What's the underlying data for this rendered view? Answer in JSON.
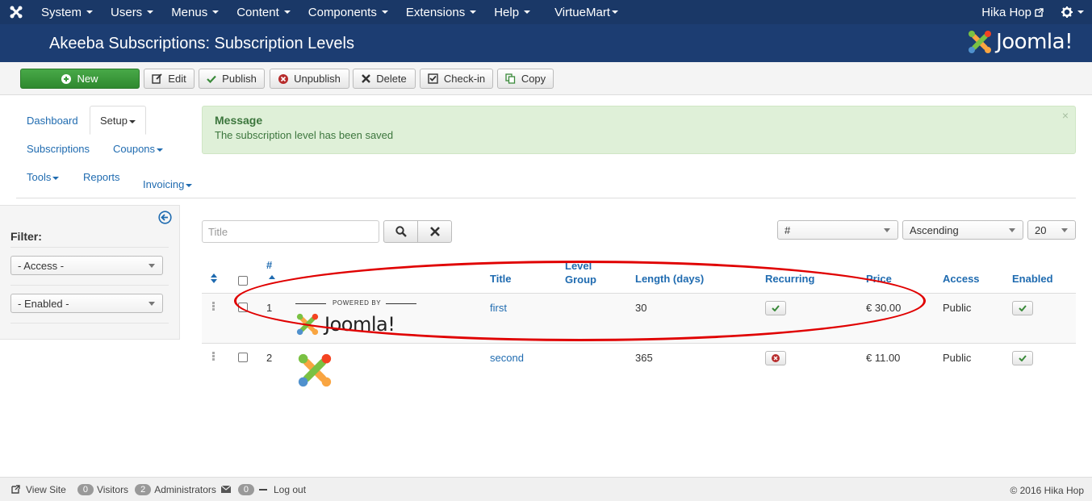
{
  "topnav": {
    "menu": [
      {
        "label": "System"
      },
      {
        "label": "Users"
      },
      {
        "label": "Menus"
      },
      {
        "label": "Content"
      },
      {
        "label": "Components"
      },
      {
        "label": "Extensions"
      },
      {
        "label": "Help"
      },
      {
        "label": "VirtueMart"
      }
    ],
    "user": "Hika Hop"
  },
  "header": {
    "title": "Akeeba Subscriptions: Subscription Levels",
    "brand": "Joomla!"
  },
  "toolbar": {
    "new": "New",
    "edit": "Edit",
    "publish": "Publish",
    "unpublish": "Unpublish",
    "delete": "Delete",
    "checkin": "Check-in",
    "copy": "Copy"
  },
  "subnav": {
    "dashboard": "Dashboard",
    "setup": "Setup",
    "subscriptions": "Subscriptions",
    "coupons": "Coupons",
    "tools": "Tools",
    "reports": "Reports",
    "invoicing": "Invoicing"
  },
  "message": {
    "heading": "Message",
    "text": "The subscription level has been saved",
    "close": "×"
  },
  "sidebar": {
    "filter_title": "Filter:",
    "access": "- Access -",
    "enabled": "- Enabled -"
  },
  "search": {
    "placeholder": "Title"
  },
  "list_controls": {
    "order_by": "#",
    "direction": "Ascending",
    "limit": "20"
  },
  "table": {
    "headers": {
      "num": "#",
      "title": "Title",
      "level_group": "Level Group",
      "length": "Length (days)",
      "recurring": "Recurring",
      "price": "Price",
      "access": "Access",
      "enabled": "Enabled"
    },
    "rows": [
      {
        "num": "1",
        "title": "first",
        "length": "30",
        "recurring": true,
        "price": "€ 30.00",
        "access": "Public",
        "enabled": true,
        "image_caption": "POWERED BY",
        "image_word": "Joomla!"
      },
      {
        "num": "2",
        "title": "second",
        "length": "365",
        "recurring": false,
        "price": "€ 11.00",
        "access": "Public",
        "enabled": true
      }
    ]
  },
  "footer": {
    "view_site": "View Site",
    "visitors_count": "0",
    "visitors": "Visitors",
    "admins_count": "2",
    "admins": "Administrators",
    "messages_count": "0",
    "logout": "Log out",
    "copyright": "© 2016 Hika Hop"
  },
  "colors": {
    "nav_bg": "#1a3867",
    "header_bg": "#1c3d72",
    "link": "#1f6bb0",
    "success_bg": "#dff0d8",
    "success_text": "#3c763d",
    "new_button": "#3a9b3a",
    "annotation": "#e00000"
  }
}
